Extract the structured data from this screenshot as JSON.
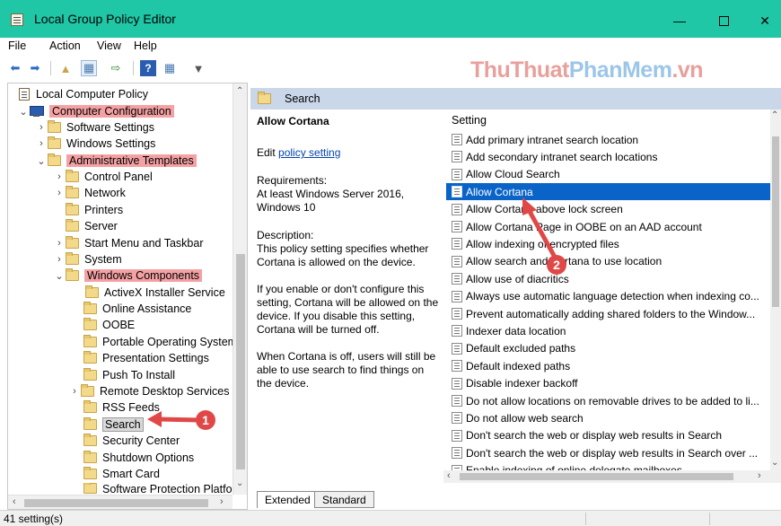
{
  "window": {
    "title": "Local Group Policy Editor",
    "min_icon": "minimize-icon",
    "max_icon": "maximize-icon",
    "close_icon": "close-icon"
  },
  "menu": {
    "file": "File",
    "action": "Action",
    "view": "View",
    "help": "Help"
  },
  "toolbar": {
    "icons": [
      "back-icon",
      "forward-icon",
      "up-folder-icon",
      "show-hide-tree-icon",
      "export-list-icon",
      "help-icon",
      "properties-icon",
      "filter-icon"
    ]
  },
  "watermark": {
    "part1": "ThuThuat",
    "part2": "PhanMem",
    "part3": ".vn"
  },
  "tree": {
    "root": "Local Computer Policy",
    "computer_config": "Computer Configuration",
    "software_settings": "Software Settings",
    "windows_settings": "Windows Settings",
    "admin_templates": "Administrative Templates",
    "control_panel": "Control Panel",
    "network": "Network",
    "printers": "Printers",
    "server": "Server",
    "start_menu": "Start Menu and Taskbar",
    "system": "System",
    "windows_components": "Windows Components",
    "activex": "ActiveX Installer Service",
    "online_assistance": "Online Assistance",
    "oobe": "OOBE",
    "portable_os": "Portable Operating System",
    "presentation": "Presentation Settings",
    "push_install": "Push To Install",
    "remote_desktop": "Remote Desktop Services",
    "rss": "RSS Feeds",
    "search": "Search",
    "security_center": "Security Center",
    "shutdown": "Shutdown Options",
    "smart_card": "Smart Card",
    "software_protection": "Software Protection Platform"
  },
  "right_pane": {
    "header": "Search",
    "setting_title": "Allow Cortana",
    "edit_prefix": "Edit ",
    "edit_link": "policy setting",
    "requirements_label": "Requirements:",
    "requirements_text": "At least Windows Server 2016, Windows 10",
    "description_label": "Description:",
    "description_text": "This policy setting specifies whether Cortana is allowed on the device.",
    "description_text2": "If you enable or don't configure this setting, Cortana will be allowed on the device. If you disable this setting, Cortana will be turned off.",
    "description_text3": "When Cortana is off, users will still be able to use search to find things on the device.",
    "column_header": "Setting",
    "settings": [
      "Add primary intranet search location",
      "Add secondary intranet search locations",
      "Allow Cloud Search",
      "Allow Cortana",
      "Allow Cortana above lock screen",
      "Allow Cortana Page in OOBE on an AAD account",
      "Allow indexing of encrypted files",
      "Allow search and Cortana to use location",
      "Allow use of diacritics",
      "Always use automatic language detection when indexing co...",
      "Prevent automatically adding shared folders to the Window...",
      "Indexer data location",
      "Default excluded paths",
      "Default indexed paths",
      "Disable indexer backoff",
      "Do not allow locations on removable drives to be added to li...",
      "Do not allow web search",
      "Don't search the web or display web results in Search",
      "Don't search the web or display web results in Search over ...",
      "Enable indexing of online delegate mailboxes"
    ],
    "selected_index": 3,
    "tab_extended": "Extended",
    "tab_standard": "Standard"
  },
  "status": {
    "text": "41 setting(s)"
  },
  "markers": {
    "one": "1",
    "two": "2"
  },
  "colors": {
    "titlebar": "#1fc7a6",
    "highlight": "#f4a1a4",
    "selected_row": "#0a64c8",
    "marker": "#e04848"
  }
}
